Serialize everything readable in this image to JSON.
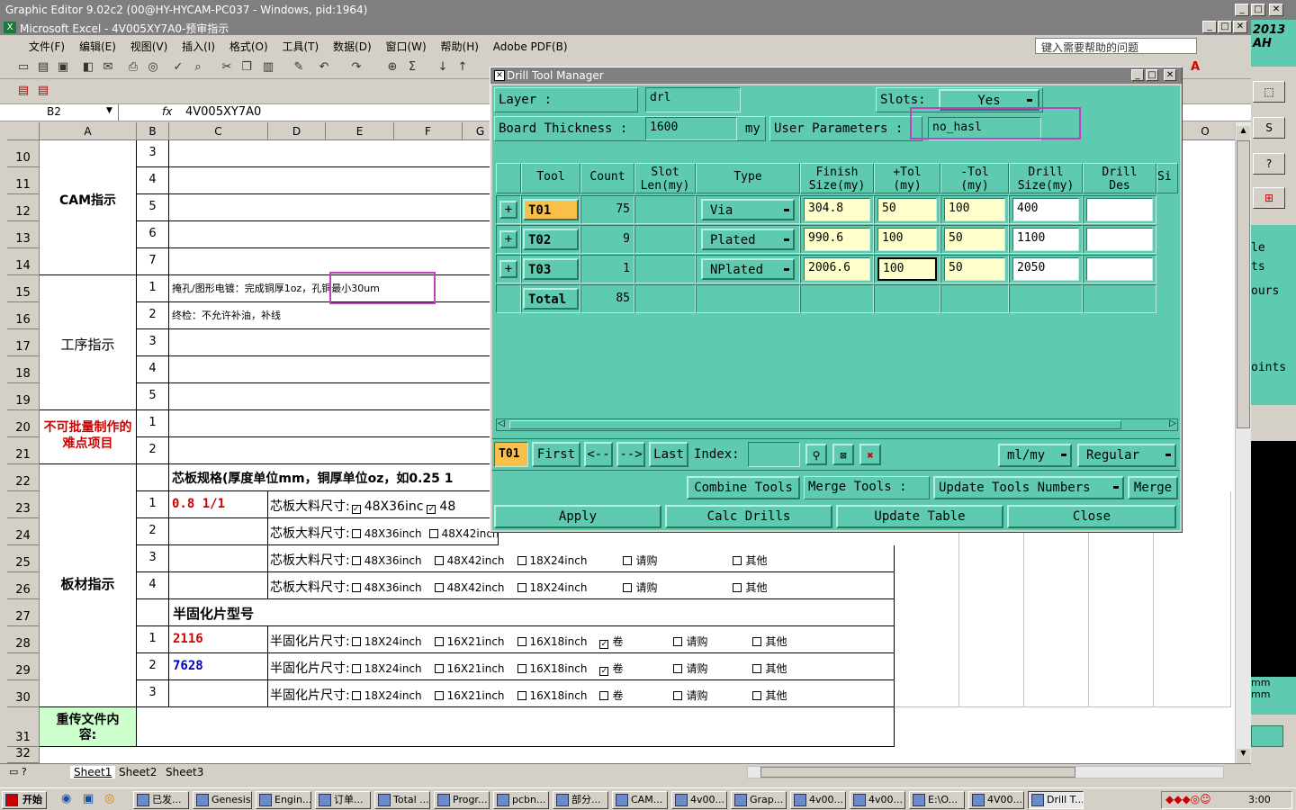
{
  "graphic_editor": {
    "title": "Graphic Editor 9.02c2 (00@HY-HYCAM-PC037 - Windows, pid:1964)"
  },
  "excel": {
    "title": "Microsoft Excel - 4V005XY7A0-预审指示",
    "menu": [
      "文件(F)",
      "编辑(E)",
      "视图(V)",
      "插入(I)",
      "格式(O)",
      "工具(T)",
      "数据(D)",
      "窗口(W)",
      "帮助(H)",
      "Adobe PDF(B)"
    ],
    "help_placeholder": "键入需要帮助的问题",
    "name_box": "B2",
    "fx": "fx",
    "formula": "4V005XY7A0",
    "columns": [
      "A",
      "B",
      "C",
      "D",
      "E",
      "F",
      "G"
    ],
    "rows": [
      "10",
      "11",
      "12",
      "13",
      "14",
      "15",
      "16",
      "17",
      "18",
      "19",
      "20",
      "21",
      "22",
      "23",
      "24",
      "25",
      "26",
      "27",
      "28",
      "29",
      "30",
      "31",
      "32"
    ],
    "cam_label": "CAM指示",
    "cam_nums": [
      "3",
      "4",
      "5",
      "6",
      "7"
    ],
    "process_label": "工序指示",
    "process_nums": [
      "1",
      "2",
      "3",
      "4",
      "5"
    ],
    "process_line1_a": "掩孔/图形电镀：完成铜厚1oz，",
    "process_line1_b": "孔铜最小30um",
    "process_line2": "终检：不允许补油，补线",
    "difficult_label": "不可批量制作的难点项目",
    "difficult_nums": [
      "1",
      "2"
    ],
    "board_label": "板材指示",
    "core_spec": "芯板规格(厚度单位mm，铜厚单位oz，如0.25 1",
    "core_nums": [
      "1",
      "2",
      "3",
      "4"
    ],
    "core_val": "0.8 1/1",
    "core_size_label": "芯板大料尺寸:",
    "core_opts": [
      "48X36inch",
      "48X42inch",
      "18X24inch",
      "请购",
      "其他"
    ],
    "core_row1_first": "48X36inc",
    "core_row1_second": "48",
    "prepreg_title": "半固化片型号",
    "prepreg_nums": [
      "1",
      "2",
      "3"
    ],
    "prepreg_vals": [
      "2116",
      "7628",
      ""
    ],
    "prepreg_size_label": "半固化片尺寸:",
    "prepreg_opts": [
      "18X24inch",
      "16X21inch",
      "16X18inch",
      "卷",
      "请购",
      "其他"
    ],
    "reupload_label": "重传文件内容:",
    "sheets": [
      "Sheet1",
      "Sheet2",
      "Sheet3"
    ]
  },
  "right_panel": {
    "texts": [
      "2013",
      "AH",
      "le",
      "ts",
      "ours",
      "oints",
      "mm",
      "mm"
    ]
  },
  "dialog": {
    "title": "Drill Tool Manager",
    "layer_label": "Layer      :",
    "layer_value": "drl",
    "slots_label": "Slots:",
    "slots_value": "Yes",
    "thickness_label": "Board Thickness :",
    "thickness_value": "1600",
    "thickness_unit": "my",
    "user_params_label": "User Parameters :",
    "user_params_value": "no_hasl",
    "headers": [
      "Tool",
      "Count",
      "Slot\nLen(my)",
      "Type",
      "Finish\nSize(my)",
      "+Tol\n(my)",
      "-Tol\n(my)",
      "Drill\nSize(my)",
      "Drill\nDes",
      "Si"
    ],
    "rows": [
      {
        "tool": "T01",
        "count": "75",
        "type": "Via",
        "finish": "304.8",
        "ptol": "50",
        "ntol": "100",
        "drill": "400",
        "des": ""
      },
      {
        "tool": "T02",
        "count": "9",
        "type": "Plated",
        "finish": "990.6",
        "ptol": "100",
        "ntol": "50",
        "drill": "1100",
        "des": ""
      },
      {
        "tool": "T03",
        "count": "1",
        "type": "NPlated",
        "finish": "2006.6",
        "ptol": "100",
        "ntol": "50",
        "drill": "2050",
        "des": ""
      }
    ],
    "total_label": "Total",
    "total_count": "85",
    "nav": {
      "current": "T01",
      "first": "First",
      "prev": "<--",
      "next": "-->",
      "last": "Last",
      "index_label": "Index:",
      "units": "ml/my",
      "mode": "Regular"
    },
    "buttons": {
      "combine": "Combine Tools",
      "merge_label": "Merge Tools :",
      "update_numbers": "Update Tools Numbers",
      "merge": "Merge",
      "apply": "Apply",
      "calc": "Calc Drills",
      "update_table": "Update Table",
      "close": "Close"
    }
  },
  "taskbar": {
    "start": "开始",
    "tasks": [
      "已发...",
      "Genesis",
      "Engin...",
      "订单...",
      "Total ...",
      "Progr...",
      "pcbn...",
      "部分...",
      "CAM...",
      "4v00...",
      "Grap...",
      "4v00...",
      "4v00...",
      "E:\\O...",
      "4V00...",
      "Drill T..."
    ],
    "clock": "3:00"
  }
}
